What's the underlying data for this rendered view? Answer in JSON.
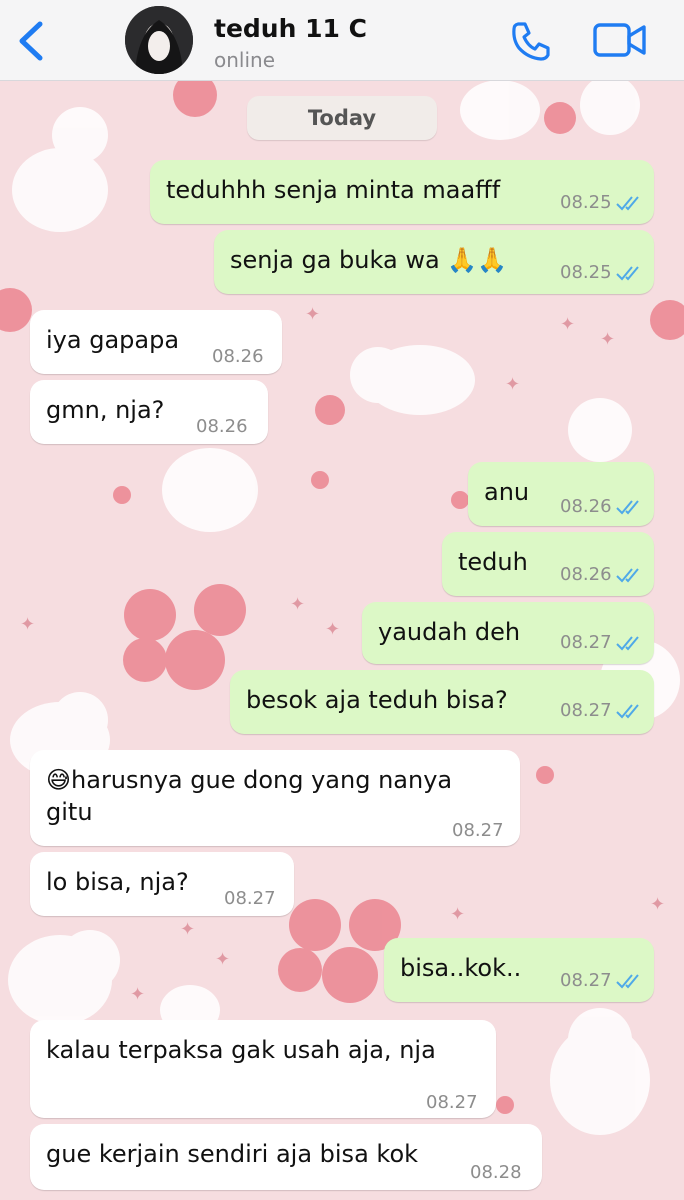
{
  "header": {
    "contact_name": "teduh 11 C",
    "status": "online"
  },
  "date_divider": "Today",
  "colors": {
    "accent": "#1f7cf2",
    "outgoing_bubble": "#dcf8c6",
    "incoming_bubble": "#ffffff",
    "wallpaper": "#f6dde0",
    "read_ticks": "#4fa9e8"
  },
  "messages": [
    {
      "direction": "out",
      "text": "teduhhh senja minta maafff",
      "time": "08.25",
      "status": "read"
    },
    {
      "direction": "out",
      "text": "senja ga buka wa 🙏🙏",
      "time": "08.25",
      "status": "read"
    },
    {
      "direction": "in",
      "text": "iya gapapa",
      "time": "08.26"
    },
    {
      "direction": "in",
      "text": "gmn, nja?",
      "time": "08.26"
    },
    {
      "direction": "out",
      "text": "anu",
      "time": "08.26",
      "status": "read"
    },
    {
      "direction": "out",
      "text": "teduh",
      "time": "08.26",
      "status": "read"
    },
    {
      "direction": "out",
      "text": "yaudah deh",
      "time": "08.27",
      "status": "read"
    },
    {
      "direction": "out",
      "text": "besok aja teduh bisa?",
      "time": "08.27",
      "status": "read"
    },
    {
      "direction": "in",
      "text": "😅harusnya gue dong yang nanya gitu",
      "time": "08.27"
    },
    {
      "direction": "in",
      "text": "lo bisa, nja?",
      "time": "08.27"
    },
    {
      "direction": "out",
      "text": "bisa..kok..",
      "time": "08.27",
      "status": "read"
    },
    {
      "direction": "in",
      "text": "kalau terpaksa gak usah aja, nja",
      "time": "08.27"
    },
    {
      "direction": "in",
      "text": "gue kerjain sendiri aja bisa kok",
      "time": "08.28"
    }
  ]
}
